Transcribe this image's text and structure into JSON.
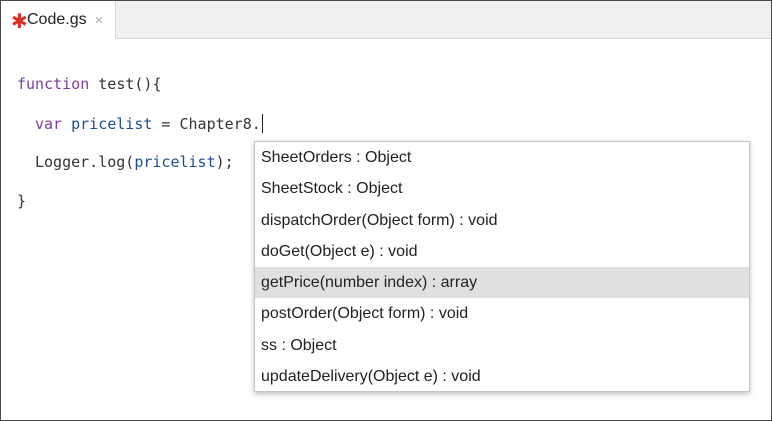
{
  "tab": {
    "modified_marker": "✱",
    "filename": "Code.gs",
    "close": "×"
  },
  "code": {
    "line1": {
      "keyword": "function",
      "rest": " test(){"
    },
    "line2": {
      "keyword": "var",
      "varname": "pricelist",
      "rest": " = Chapter8."
    },
    "line3": {
      "prefix": "Logger.log(",
      "arg": "pricelist",
      "suffix": ");"
    },
    "line4": {
      "text": "}"
    }
  },
  "autocomplete": {
    "selected_index": 4,
    "items": [
      "SheetOrders : Object",
      "SheetStock : Object",
      "dispatchOrder(Object form) : void",
      "doGet(Object e) : void",
      "getPrice(number index) : array",
      "postOrder(Object form) : void",
      "ss : Object",
      "updateDelivery(Object e) : void"
    ]
  },
  "colors": {
    "keyword": "#7a3e9d",
    "variable": "#1f4e8f",
    "modified_marker": "#d93025",
    "selection_bg": "#e0e0e0"
  }
}
